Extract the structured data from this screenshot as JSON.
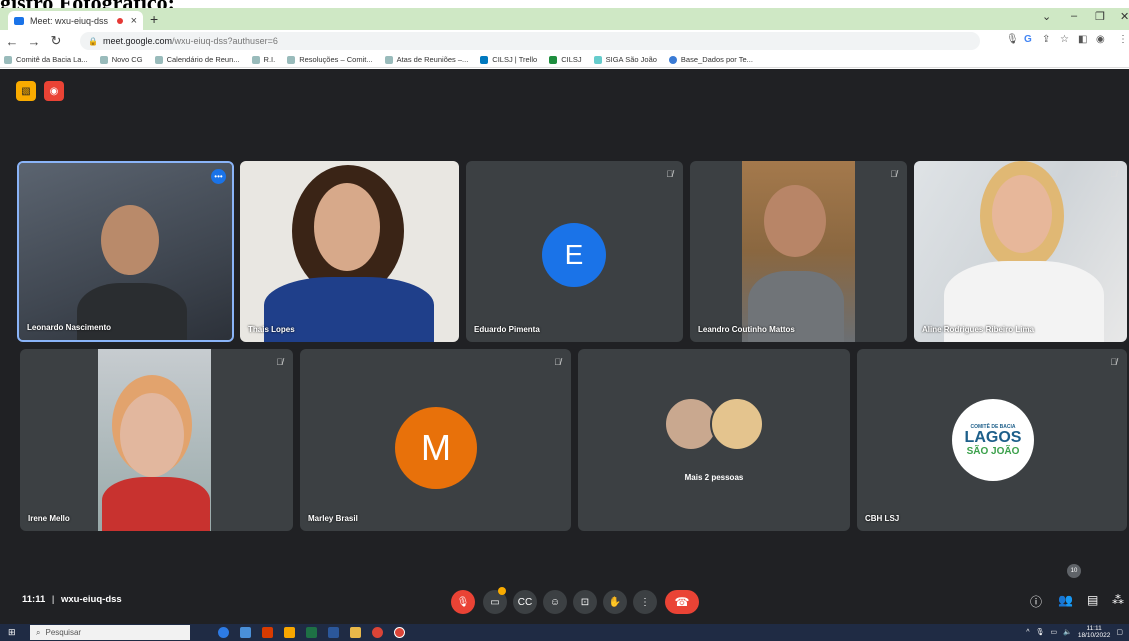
{
  "document": {
    "heading": "gistro Fotográfico:"
  },
  "browser": {
    "tab_title": "Meet: wxu-eiuq-dss",
    "close_glyph": "×",
    "newtab_glyph": "+",
    "url_host": "meet.google.com",
    "url_path": "/wxu-eiuq-dss?authuser=6",
    "bookmarks": [
      "Comitê da Bacia La...",
      "Novo CG",
      "Calendário de Reun...",
      "R.I.",
      "Resoluções – Comit...",
      "Atas de Reuniões –...",
      "CILSJ | Trello",
      "CILSJ",
      "SIGA São João",
      "Base_Dados por Te..."
    ]
  },
  "meet": {
    "participants": [
      {
        "name": "Leonardo Nascimento"
      },
      {
        "name": "Thais Lopes"
      },
      {
        "name": "Eduardo Pimenta",
        "initial": "E"
      },
      {
        "name": "Leandro Coutinho Mattos"
      },
      {
        "name": "Aline Rodrigues Ribeiro Lima"
      },
      {
        "name": "Irene Mello"
      },
      {
        "name": "Marley Brasil",
        "initial": "M"
      },
      {
        "name": "Mais 2 pessoas"
      },
      {
        "name": "CBH LSJ"
      }
    ],
    "logo": {
      "line1": "COMITÊ DE BACIA",
      "line2": "LAGOS",
      "line3": "SÃO JOÃO"
    },
    "time": "11:11",
    "separator": "|",
    "meeting_code": "wxu-eiuq-dss",
    "participant_count": "10",
    "colors": {
      "blue_avatar": "#1a73e8",
      "orange_avatar": "#e8710a",
      "end_call": "#ea4335",
      "stage": "#202124",
      "tile": "#3c4043"
    }
  },
  "taskbar": {
    "search_placeholder": "Pesquisar",
    "clock_time": "11:11",
    "clock_date": "18/10/2022"
  }
}
